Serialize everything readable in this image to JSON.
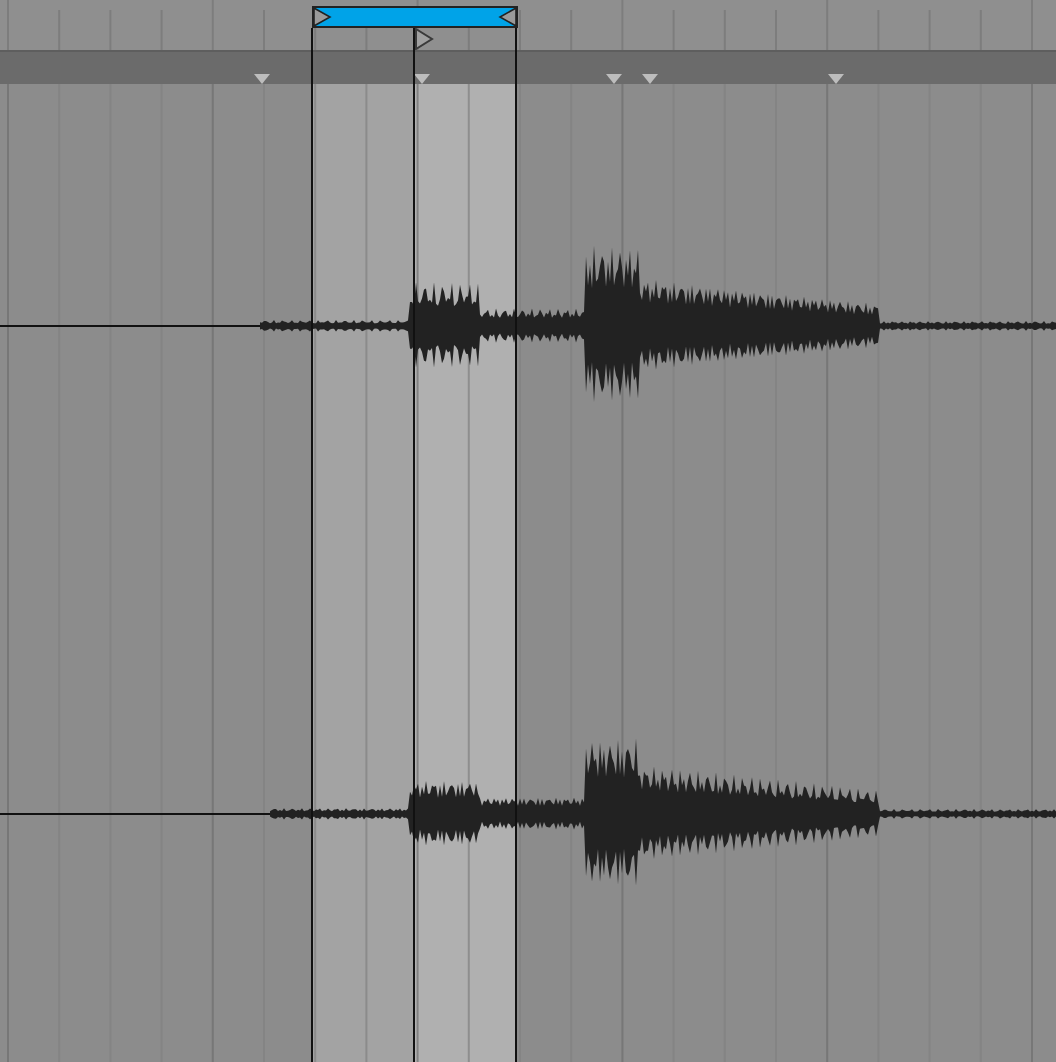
{
  "loop_brace": {
    "active": true
  }
}
